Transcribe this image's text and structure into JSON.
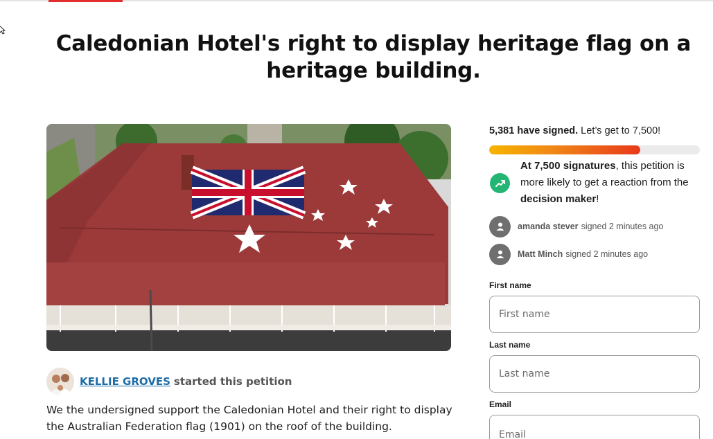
{
  "petition": {
    "title": "Caledonian Hotel's right to display heritage flag on a heritage building.",
    "starter_name": "KELLIE GROVES",
    "starter_action": "started this petition",
    "description": "We the undersigned support the Caledonian Hotel and their right to display the Australian Federation flag (1901) on the roof of the building."
  },
  "progress": {
    "signed_count": "5,381 have signed.",
    "goal_text": " Let’s get to 7,500!",
    "fraction": 0.7175
  },
  "goal": {
    "bold_part": "At 7,500 signatures",
    "middle": ", this petition is more likely to get a reaction from the ",
    "bold_end": "decision maker",
    "end": "!"
  },
  "recent_signers": [
    {
      "name": "amanda stever",
      "time": "signed 2 minutes ago"
    },
    {
      "name": "Matt Minch",
      "time": "signed 2 minutes ago"
    }
  ],
  "form": {
    "first_name_label": "First name",
    "first_name_placeholder": "First name",
    "last_name_label": "Last name",
    "last_name_placeholder": "Last name",
    "email_label": "Email",
    "email_placeholder": "Email"
  },
  "colors": {
    "link": "#1b6ca8",
    "accent_red": "#e42d2d",
    "goal_green": "#22b573",
    "roof": "#9c3a3a"
  },
  "icons": {
    "goal": "trending-up-icon",
    "signer": "user-icon",
    "cursor": "mouse-pointer-icon"
  }
}
